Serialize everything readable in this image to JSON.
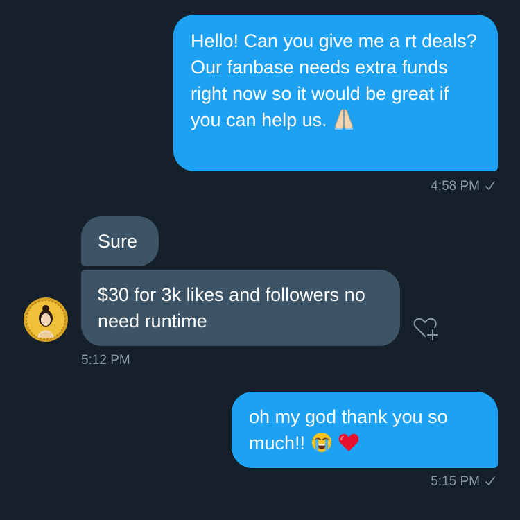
{
  "conversation": {
    "messages": [
      {
        "direction": "sent",
        "text": "Hello! Can you give me a rt deals? Our fanbase needs extra funds right now so it would be great if you can help us.",
        "emojis": [
          "folded-hands"
        ],
        "time": "4:58 PM"
      },
      {
        "direction": "received",
        "text": "Sure"
      },
      {
        "direction": "received",
        "text": "$30 for 3k likes and followers no need runtime",
        "time": "5:12 PM"
      },
      {
        "direction": "sent",
        "text": "oh my god thank you so much!!",
        "emojis": [
          "loudly-crying-face",
          "red-heart"
        ],
        "time": "5:15 PM"
      }
    ]
  },
  "icons": {
    "read_receipt": "check-icon",
    "reaction": "heart-plus-icon",
    "avatar": "avatar-gold-medallion"
  },
  "colors": {
    "background": "#15202b",
    "sent_bubble": "#1da1f2",
    "received_bubble": "#3d5466",
    "timestamp": "#8899a6",
    "text": "#ffffff"
  }
}
